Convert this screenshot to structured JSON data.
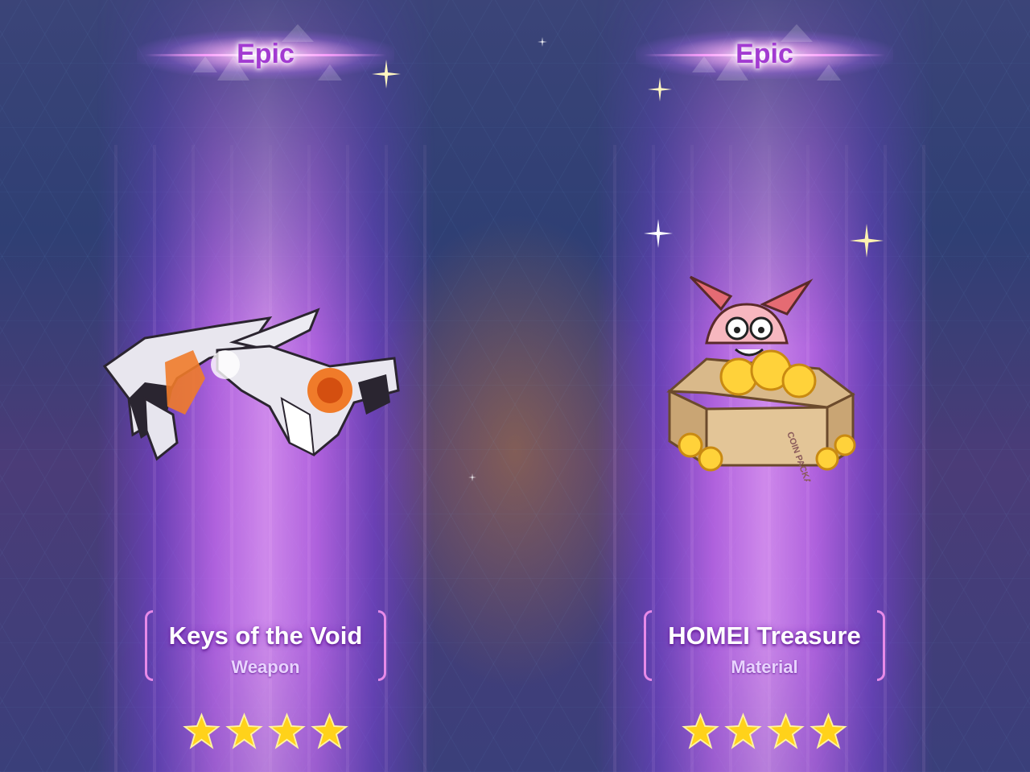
{
  "cards": [
    {
      "rarity": "Epic",
      "name": "Keys of the Void",
      "type": "Weapon",
      "stars": 4,
      "art_icon": "dual-pistols-weapon-icon"
    },
    {
      "rarity": "Epic",
      "name": "HOMEI Treasure",
      "type": "Material",
      "stars": 4,
      "art_icon": "coin-package-box-icon",
      "art_text": "COIN PACKAGE"
    }
  ],
  "colors": {
    "rarity_text": "#a23bd1",
    "beam": "#c86cff",
    "bracket": "#e78ae8",
    "star": "#ffd21a"
  }
}
